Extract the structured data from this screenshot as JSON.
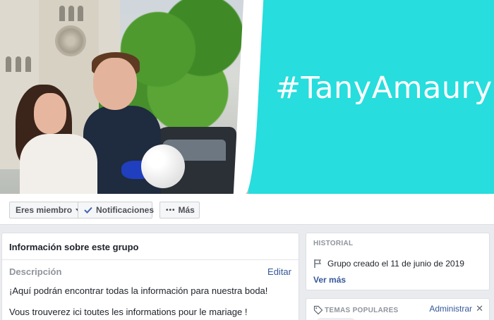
{
  "cover": {
    "hashtag": "#TanyAmaury",
    "photo_alt": "wedding-couple-photo",
    "accent_color": "#27dddd"
  },
  "actions": {
    "member_label": "Eres miembro",
    "notifications_label": "Notificaciones",
    "more_label": "Más"
  },
  "about": {
    "title": "Información sobre este grupo",
    "description_label": "Descripción",
    "edit_label": "Editar",
    "lines": [
      "¡Aquí podrán encontrar todas la información para nuestra boda!",
      "Vous trouverez ici toutes les informations pour le mariage !"
    ]
  },
  "history": {
    "title": "HISTORIAL",
    "created_text": "Grupo creado el 11 de junio de 2019",
    "see_more": "Ver más"
  },
  "topics": {
    "title": "TEMAS POPULARES",
    "admin_label": "Administrar",
    "close_glyph": "✕"
  }
}
